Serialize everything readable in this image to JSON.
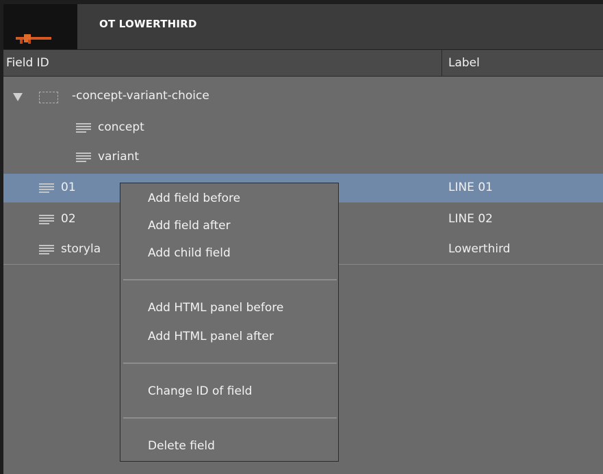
{
  "window": {
    "title": "OT LOWERTHIRD"
  },
  "columns": {
    "field_id": "Field ID",
    "label": "Label"
  },
  "tree": {
    "group": "-concept-variant-choice",
    "group_children": [
      "concept",
      "variant"
    ],
    "rows": [
      {
        "id": "01",
        "label": "LINE 01",
        "selected": true
      },
      {
        "id": "02",
        "label": "LINE 02",
        "selected": false
      },
      {
        "id": "storyla",
        "label": "Lowerthird",
        "selected": false
      }
    ]
  },
  "context_menu": {
    "add_field_before": "Add field before",
    "add_field_after": "Add field after",
    "add_child_field": "Add child field",
    "add_html_panel_before": "Add HTML panel before",
    "add_html_panel_after": "Add HTML panel after",
    "change_id": "Change ID of field",
    "delete_field": "Delete field"
  },
  "colors": {
    "selected_row": "#7189a8",
    "background": "#6b6b6b",
    "header": "#4a4a4a",
    "titlebar": "#3c3c3c"
  },
  "icons": [
    "expand-triangle-icon",
    "folder-icon",
    "text-field-icon",
    "logo-icon"
  ]
}
